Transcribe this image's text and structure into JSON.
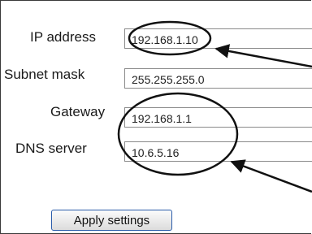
{
  "form": {
    "ip": {
      "label": "IP address",
      "value": "192.168.1.10"
    },
    "subnet": {
      "label": "Subnet mask",
      "value": "255.255.255.0"
    },
    "gateway": {
      "label": "Gateway",
      "value": "192.168.1.1"
    },
    "dns": {
      "label": "DNS server",
      "value": "10.6.5.16"
    },
    "apply_label": "Apply settings"
  }
}
